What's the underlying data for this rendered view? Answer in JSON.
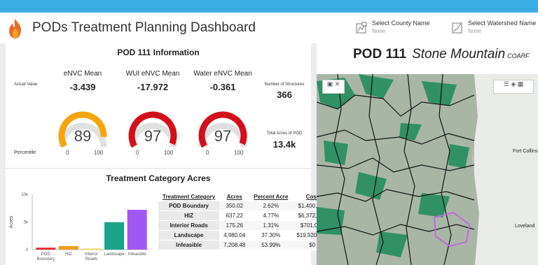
{
  "colors": {
    "accent": "#3aaee4",
    "orange": "#f6a50f",
    "red": "#d40f1c",
    "teal": "#1aa38a",
    "purple": "#a157f3",
    "yellow": "#f2d25c"
  },
  "header": {
    "title": "PODs Treatment Planning Dashboard",
    "county": {
      "label": "Select County Name",
      "value": "None"
    },
    "watershed": {
      "label": "Select Watershed Name",
      "value": "None"
    }
  },
  "info": {
    "title": "POD 111 Information",
    "actual_label": "Actual Value",
    "percentile_label": "Percentile",
    "metrics": [
      {
        "name": "eNVC Mean",
        "value": "-3.439",
        "percentile": 89,
        "percentile_text": "89",
        "gauge_color": "#f6a50f",
        "min": "0",
        "max": "100"
      },
      {
        "name": "WUI eNVC Mean",
        "value": "-17.972",
        "percentile": 97,
        "percentile_text": "97",
        "gauge_color": "#d40f1c",
        "min": "0",
        "max": "100"
      },
      {
        "name": "Water eNVC Mean",
        "value": "-0.361",
        "percentile": 97,
        "percentile_text": "97",
        "gauge_color": "#d40f1c",
        "min": "0",
        "max": "100"
      }
    ],
    "structures": {
      "label": "Number of Structures",
      "value": "366"
    },
    "total_acres": {
      "label": "Total Acres of POD",
      "value": "13.4k"
    }
  },
  "acres_panel": {
    "title": "Treatment Category Acres",
    "table": {
      "headers": [
        "Treatment Category",
        "Acres",
        "Percent Acre",
        "Cost"
      ],
      "rows": [
        [
          "POD Boundary",
          "350.02",
          "2.62%",
          "$1,400,089"
        ],
        [
          "HIZ",
          "637.22",
          "4.77%",
          "$6,372,224"
        ],
        [
          "Interior Roads",
          "175.26",
          "1.31%",
          "$701,031"
        ],
        [
          "Landscape",
          "4,980.04",
          "37.30%",
          "$19,920,154"
        ],
        [
          "Infeasible",
          "7,208.48",
          "53.99%",
          "$0"
        ]
      ]
    }
  },
  "chart_data": {
    "type": "bar",
    "categories": [
      "POD Boundary",
      "HIZ",
      "Interior Roads",
      "Landscape",
      "Infeasible"
    ],
    "tick_labels": [
      [
        "POD",
        "Boundary"
      ],
      [
        "HIZ"
      ],
      [
        "Interior",
        "Roads"
      ],
      [
        "Landscape"
      ],
      [
        "Infeasible"
      ]
    ],
    "values": [
      350.02,
      637.22,
      175.26,
      4980.04,
      7208.48
    ],
    "colors": [
      "#e8262c",
      "#f29a1f",
      "#f2d25c",
      "#1aa38a",
      "#a157f3"
    ],
    "ylabel": "Acres",
    "yticks": [
      "0",
      "5k",
      "10k"
    ],
    "ylim": [
      0,
      10000
    ],
    "grid": false
  },
  "map": {
    "pod": "POD 111",
    "name": "Stone Mountain",
    "abbr": "COARF",
    "labels": [
      "Fort Collins",
      "Loveland"
    ]
  }
}
